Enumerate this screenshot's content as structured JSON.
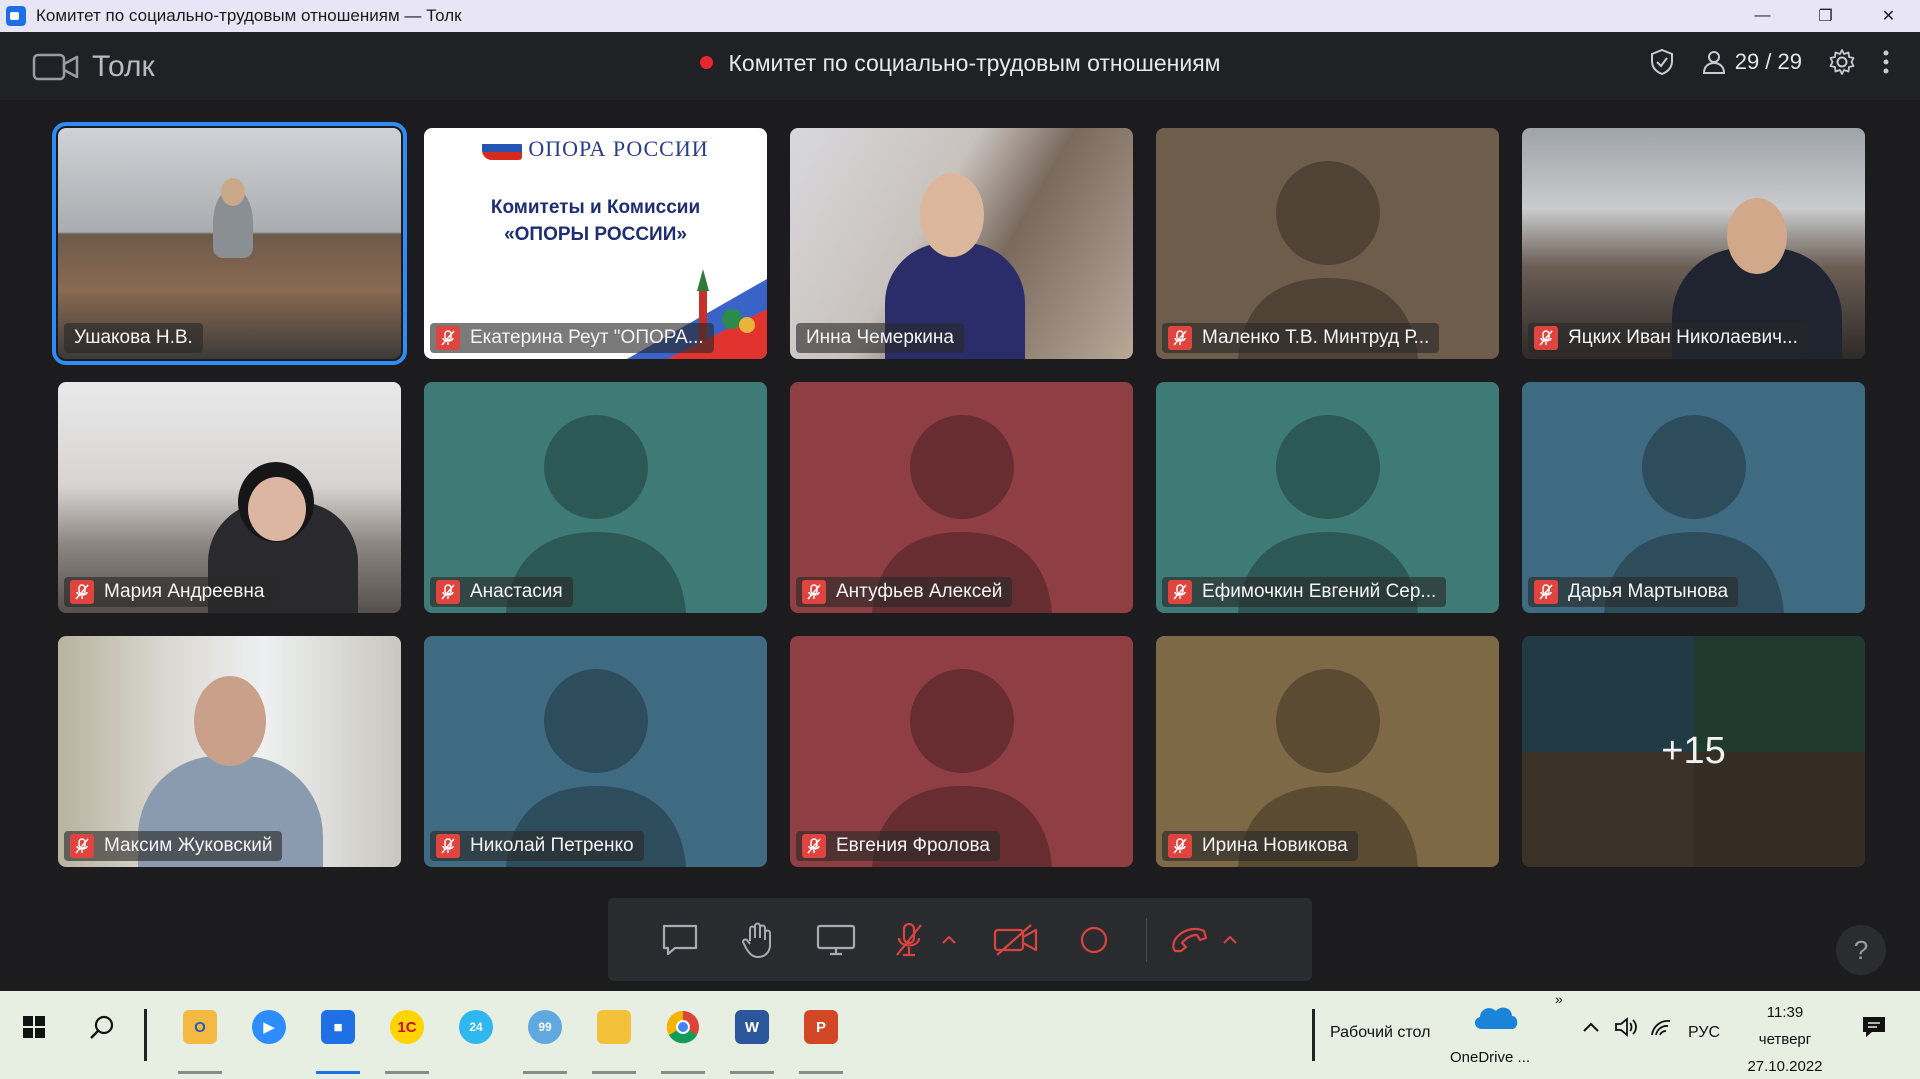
{
  "window": {
    "title": "Комитет по социально-трудовым отношениям — Толк",
    "controls": {
      "minimize": "—",
      "restore": "❐",
      "close": "✕"
    }
  },
  "header": {
    "brand": "Толк",
    "meeting_title": "Комитет по социально-трудовым отношениям",
    "participants_count": "29 / 29"
  },
  "tiles": [
    {
      "name": "Ушакова Н.В.",
      "mic_muted": false,
      "kind": "photo1",
      "active": true
    },
    {
      "name": "Екатерина Реут \"ОПОРА...",
      "mic_muted": true,
      "kind": "slide"
    },
    {
      "name": "Инна Чемеркина",
      "mic_muted": false,
      "kind": "photo3"
    },
    {
      "name": "Маленко Т.В. Минтруд Р...",
      "mic_muted": true,
      "kind": "avatar",
      "color": "#6f5d4c"
    },
    {
      "name": "Яцких Иван Николаевич...",
      "mic_muted": true,
      "kind": "photo4"
    },
    {
      "name": "Мария Андреевна",
      "mic_muted": true,
      "kind": "photo5"
    },
    {
      "name": "Анастасия",
      "mic_muted": true,
      "kind": "avatar",
      "color": "#3e7a76"
    },
    {
      "name": "Антуфьев Алексей",
      "mic_muted": true,
      "kind": "avatar",
      "color": "#8f3f43"
    },
    {
      "name": "Ефимочкин Евгений Сер...",
      "mic_muted": true,
      "kind": "avatar",
      "color": "#3e7a76"
    },
    {
      "name": "Дарья Мартынова",
      "mic_muted": true,
      "kind": "avatar",
      "color": "#3f6b82"
    },
    {
      "name": "Максим Жуковский",
      "mic_muted": true,
      "kind": "photo6"
    },
    {
      "name": "Николай Петренко",
      "mic_muted": true,
      "kind": "avatar",
      "color": "#3f6b82"
    },
    {
      "name": "Евгения Фролова",
      "mic_muted": true,
      "kind": "avatar",
      "color": "#8f3f43"
    },
    {
      "name": "Ирина Новикова",
      "mic_muted": true,
      "kind": "avatar",
      "color": "#7d6946"
    }
  ],
  "more_tile": {
    "label": "+15"
  },
  "slide": {
    "logo": "ОПОРА РОССИИ",
    "heading_line1": "Комитеты и Комиссии",
    "heading_line2": "«ОПОРЫ РОССИИ»"
  },
  "help_label": "?",
  "taskbar": {
    "desktop_label": "Рабочий стол",
    "onedrive_label": "OneDrive ...",
    "lang": "РУС",
    "time": "11:39",
    "weekday": "четверг",
    "date": "27.10.2022",
    "badge_24": "24",
    "badge_99": "99",
    "app_1c": "1С",
    "app_word": "W",
    "app_ppt": "P",
    "chevrons": "»"
  },
  "colors": {
    "accent": "#2f8bf5",
    "rec": "#e8262d",
    "mic_off": "#e0443e"
  }
}
